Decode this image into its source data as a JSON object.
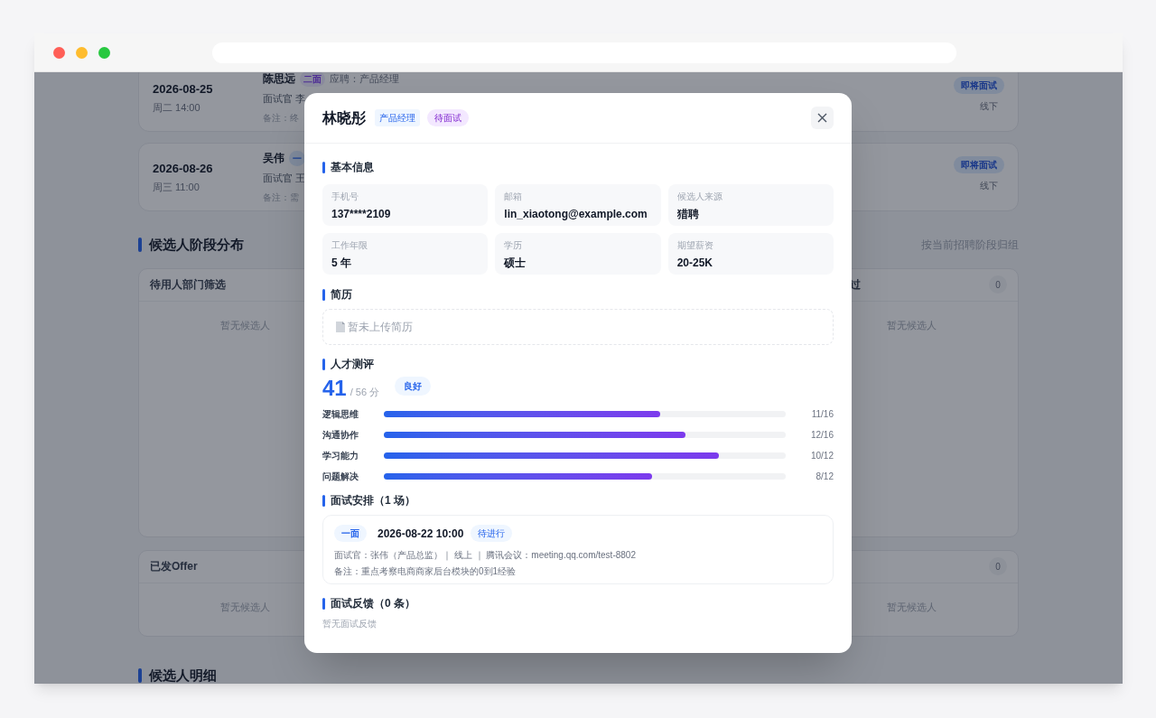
{
  "schedule": [
    {
      "date": "2026-08-25",
      "time": "周二 14:00",
      "name": "陈思远",
      "round": "二面",
      "kind": "second",
      "position": "应聘：产品经理",
      "interviewer": "面试官 李",
      "note": "备注：终",
      "status": "即将面试",
      "mode": "线下"
    },
    {
      "date": "2026-08-26",
      "time": "周三 11:00",
      "name": "吴伟",
      "round": "一",
      "kind": "first",
      "interviewer": "面试官 王",
      "note": "备注：需",
      "status": "即将面试",
      "mode": "线下"
    }
  ],
  "stages": {
    "title": "候选人阶段分布",
    "hint": "按当前招聘阶段归组",
    "rows": [
      [
        {
          "title": "待用人部门筛选",
          "empty": "暂无候选人"
        },
        null,
        null,
        {
          "title": "过",
          "count": "0",
          "empty": "暂无候选人"
        }
      ],
      [
        {
          "title": "已发Offer",
          "empty": "暂无候选人"
        },
        null,
        null,
        {
          "count": "0",
          "empty": "暂无候选人"
        }
      ]
    ]
  },
  "details_title": "候选人明细",
  "modal": {
    "name": "林晓彤",
    "tags": [
      {
        "label": "产品经理",
        "kind": "position"
      },
      {
        "label": "待面试",
        "kind": "status"
      }
    ],
    "basic": {
      "title": "基本信息",
      "fields": [
        {
          "label": "手机号",
          "value": "137****2109"
        },
        {
          "label": "邮箱",
          "value": "lin_xiaotong@example.com"
        },
        {
          "label": "候选人来源",
          "value": "猎聘"
        },
        {
          "label": "工作年限",
          "value": "5 年"
        },
        {
          "label": "学历",
          "value": "硕士"
        },
        {
          "label": "期望薪资",
          "value": "20-25K"
        }
      ]
    },
    "resume": {
      "title": "简历",
      "empty": "暂未上传简历"
    },
    "assessment": {
      "title": "人才测评",
      "score": "41",
      "total": "/ 56 分",
      "grade": "良好",
      "items": [
        {
          "label": "逻辑思维",
          "level": 0.6875,
          "reading": "11/16"
        },
        {
          "label": "沟通协作",
          "level": 0.75,
          "reading": "12/16"
        },
        {
          "label": "学习能力",
          "level": 0.8333,
          "reading": "10/12"
        },
        {
          "label": "问题解决",
          "level": 0.6667,
          "reading": "8/12"
        }
      ]
    },
    "interviews": {
      "title": "面试安排（1 场）",
      "items": [
        {
          "round": "一面",
          "datetime": "2026-08-22 10:00",
          "status": "待进行",
          "info": "面试官：张伟（产品总监）｜ 线上 ｜ 腾讯会议：meeting.qq.com/test-8802",
          "note": "备注：重点考察电商商家后台模块的0到1经验"
        }
      ]
    },
    "feedback": {
      "title": "面试反馈（0 条）",
      "empty": "暂无面试反馈"
    }
  }
}
